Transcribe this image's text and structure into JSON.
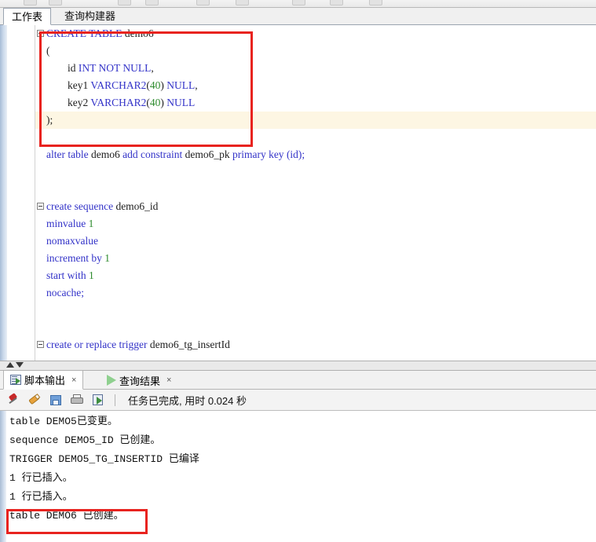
{
  "window": {
    "app_hint": "SQL Developer worksheet"
  },
  "editor_tabs": [
    {
      "label": "工作表",
      "active": true
    },
    {
      "label": "查询构建器",
      "active": false
    }
  ],
  "code": {
    "lines": [
      {
        "indent": 0,
        "fold": true,
        "tokens": [
          {
            "t": "CREATE TABLE ",
            "c": "kw"
          },
          {
            "t": "demo6",
            "c": "id"
          }
        ]
      },
      {
        "indent": 0,
        "fold": false,
        "tokens": [
          {
            "t": "(",
            "c": "pl"
          }
        ]
      },
      {
        "indent": 2,
        "fold": false,
        "tokens": [
          {
            "t": "id ",
            "c": "id"
          },
          {
            "t": "INT NOT NULL",
            "c": "kw"
          },
          {
            "t": ",",
            "c": "pl"
          }
        ]
      },
      {
        "indent": 2,
        "fold": false,
        "tokens": [
          {
            "t": "key1 ",
            "c": "id"
          },
          {
            "t": "VARCHAR2",
            "c": "ty"
          },
          {
            "t": "(",
            "c": "pl"
          },
          {
            "t": "40",
            "c": "num"
          },
          {
            "t": ") ",
            "c": "pl"
          },
          {
            "t": "NULL",
            "c": "kw"
          },
          {
            "t": ",",
            "c": "pl"
          }
        ]
      },
      {
        "indent": 2,
        "fold": false,
        "tokens": [
          {
            "t": "key2 ",
            "c": "id"
          },
          {
            "t": "VARCHAR2",
            "c": "ty"
          },
          {
            "t": "(",
            "c": "pl"
          },
          {
            "t": "40",
            "c": "num"
          },
          {
            "t": ") ",
            "c": "pl"
          },
          {
            "t": "NULL",
            "c": "kw"
          }
        ]
      },
      {
        "indent": 0,
        "fold": false,
        "highlight": true,
        "tokens": [
          {
            "t": ");",
            "c": "pl"
          }
        ]
      },
      {
        "indent": 0,
        "fold": false,
        "tokens": [
          {
            "t": "",
            "c": "pl"
          }
        ]
      },
      {
        "indent": 0,
        "fold": false,
        "tokens": [
          {
            "t": "alter table ",
            "c": "kw"
          },
          {
            "t": "demo6 ",
            "c": "id"
          },
          {
            "t": "add constraint ",
            "c": "kw"
          },
          {
            "t": "demo6_pk ",
            "c": "id"
          },
          {
            "t": "primary key ",
            "c": "kw"
          },
          {
            "t": "(id);",
            "c": "kw"
          }
        ]
      },
      {
        "indent": 0,
        "fold": false,
        "tokens": [
          {
            "t": "",
            "c": "pl"
          }
        ]
      },
      {
        "indent": 0,
        "fold": false,
        "tokens": [
          {
            "t": "",
            "c": "pl"
          }
        ]
      },
      {
        "indent": 0,
        "fold": true,
        "tokens": [
          {
            "t": "create sequence ",
            "c": "kw"
          },
          {
            "t": "demo6_id",
            "c": "id"
          }
        ]
      },
      {
        "indent": 0,
        "fold": false,
        "tokens": [
          {
            "t": "minvalue ",
            "c": "kw"
          },
          {
            "t": "1",
            "c": "num"
          }
        ]
      },
      {
        "indent": 0,
        "fold": false,
        "tokens": [
          {
            "t": "nomaxvalue",
            "c": "kw"
          }
        ]
      },
      {
        "indent": 0,
        "fold": false,
        "tokens": [
          {
            "t": "increment by ",
            "c": "kw"
          },
          {
            "t": "1",
            "c": "num"
          }
        ]
      },
      {
        "indent": 0,
        "fold": false,
        "tokens": [
          {
            "t": "start with ",
            "c": "kw"
          },
          {
            "t": "1",
            "c": "num"
          }
        ]
      },
      {
        "indent": 0,
        "fold": false,
        "tokens": [
          {
            "t": "nocache;",
            "c": "kw"
          }
        ]
      },
      {
        "indent": 0,
        "fold": false,
        "tokens": [
          {
            "t": "",
            "c": "pl"
          }
        ]
      },
      {
        "indent": 0,
        "fold": false,
        "tokens": [
          {
            "t": "",
            "c": "pl"
          }
        ]
      },
      {
        "indent": 0,
        "fold": true,
        "tokens": [
          {
            "t": "create or replace trigger ",
            "c": "kw"
          },
          {
            "t": "demo6_tg_insertId",
            "c": "id"
          }
        ]
      }
    ]
  },
  "splitter": {
    "collapse_up_icon": "triangle-up-icon",
    "collapse_down_icon": "triangle-down-icon"
  },
  "output_panel": {
    "tabs": [
      {
        "label": "脚本输出",
        "close": "×",
        "icon": "script-output-icon",
        "selected": true
      },
      {
        "label": "查询结果",
        "close": "×",
        "icon": "play-icon",
        "selected": false
      }
    ],
    "toolbar": {
      "icons": [
        {
          "name": "pin-icon"
        },
        {
          "name": "eraser-icon"
        },
        {
          "name": "save-icon"
        },
        {
          "name": "print-icon"
        },
        {
          "name": "run-script-icon"
        }
      ],
      "status": "任务已完成, 用时 0.024 秒"
    },
    "lines": [
      "table DEMO5已变更。",
      "sequence DEMO5_ID 已创建。",
      "TRIGGER DEMO5_TG_INSERTID 已编译",
      "1 行已插入。",
      "1 行已插入。",
      "table DEMO6 已创建。"
    ]
  },
  "annotations": [
    {
      "name": "create-table-highlight",
      "color": "#e8231f"
    },
    {
      "name": "output-result-highlight",
      "color": "#e8231f"
    }
  ]
}
